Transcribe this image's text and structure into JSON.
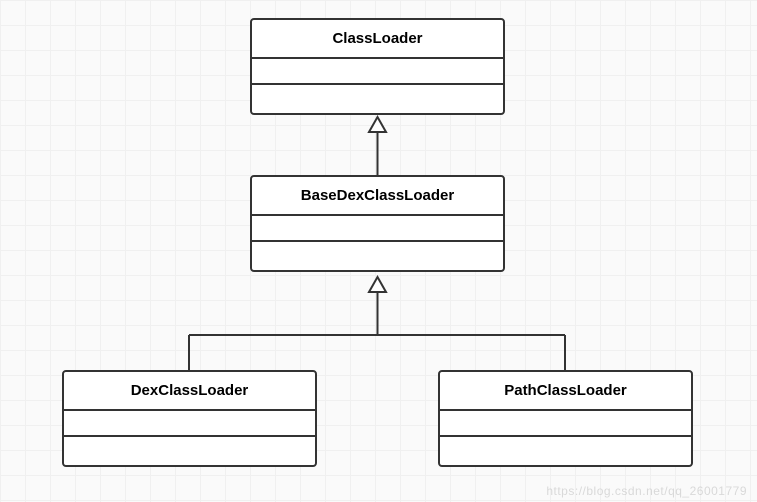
{
  "diagram": {
    "type": "uml-class-hierarchy",
    "classes": {
      "classLoader": {
        "name": "ClassLoader"
      },
      "baseDexClassLoader": {
        "name": "BaseDexClassLoader"
      },
      "dexClassLoader": {
        "name": "DexClassLoader"
      },
      "pathClassLoader": {
        "name": "PathClassLoader"
      }
    },
    "relations": [
      {
        "child": "baseDexClassLoader",
        "parent": "classLoader",
        "type": "inheritance"
      },
      {
        "child": "dexClassLoader",
        "parent": "baseDexClassLoader",
        "type": "inheritance"
      },
      {
        "child": "pathClassLoader",
        "parent": "baseDexClassLoader",
        "type": "inheritance"
      }
    ]
  },
  "watermark": "https://blog.csdn.net/qq_26001779"
}
